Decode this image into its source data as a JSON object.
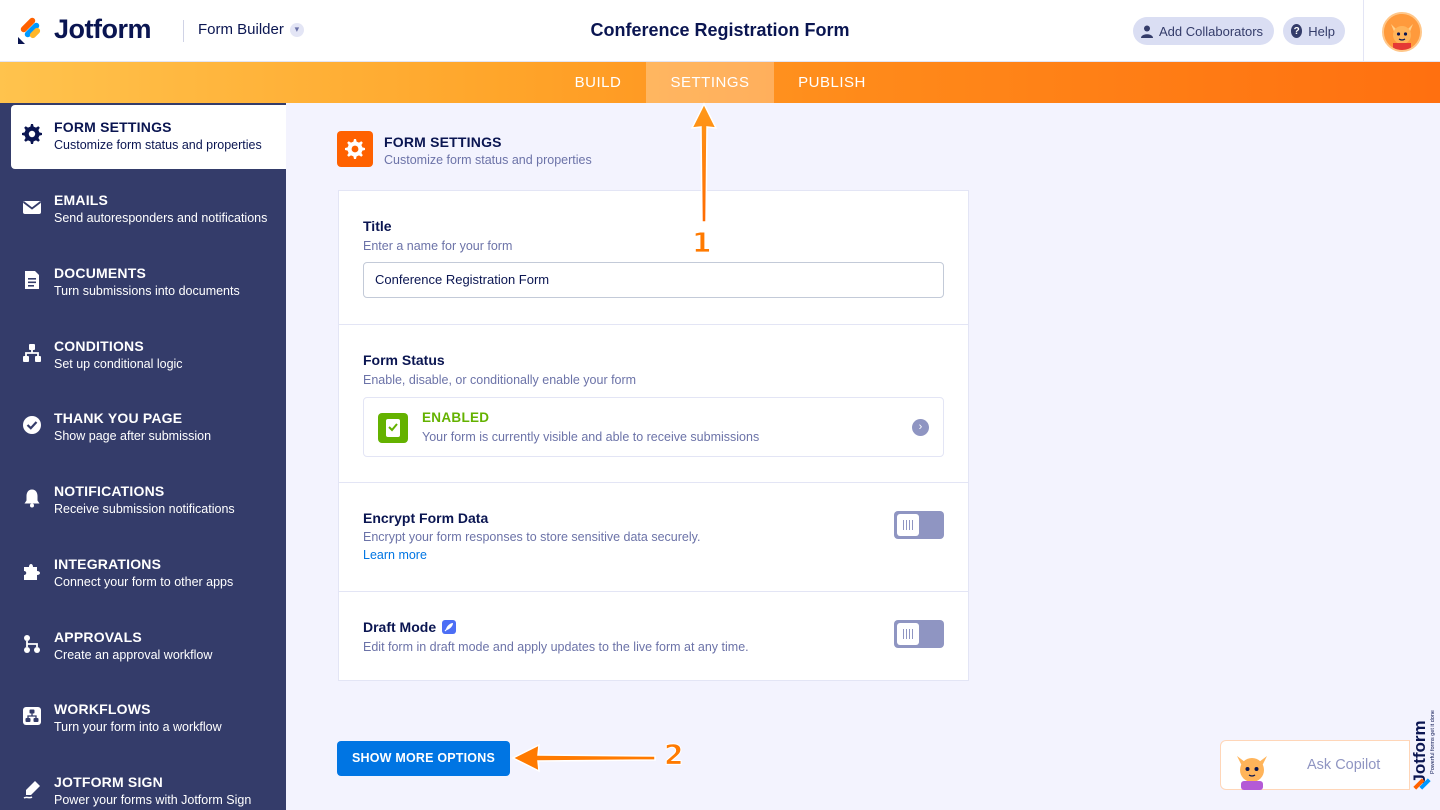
{
  "header": {
    "logo_text": "Jotform",
    "builder_label": "Form Builder",
    "form_title": "Conference Registration Form",
    "add_collaborators": "Add Collaborators",
    "help": "Help"
  },
  "tabs": [
    {
      "label": "BUILD",
      "active": false
    },
    {
      "label": "SETTINGS",
      "active": true
    },
    {
      "label": "PUBLISH",
      "active": false
    }
  ],
  "sidebar": {
    "items": [
      {
        "title": "FORM SETTINGS",
        "subtitle": "Customize form status and properties",
        "icon": "gear-icon",
        "active": true
      },
      {
        "title": "EMAILS",
        "subtitle": "Send autoresponders and notifications",
        "icon": "envelope-icon"
      },
      {
        "title": "DOCUMENTS",
        "subtitle": "Turn submissions into documents",
        "icon": "document-icon"
      },
      {
        "title": "CONDITIONS",
        "subtitle": "Set up conditional logic",
        "icon": "conditions-icon"
      },
      {
        "title": "THANK YOU PAGE",
        "subtitle": "Show page after submission",
        "icon": "check-circle-icon"
      },
      {
        "title": "NOTIFICATIONS",
        "subtitle": "Receive submission notifications",
        "icon": "bell-icon"
      },
      {
        "title": "INTEGRATIONS",
        "subtitle": "Connect your form to other apps",
        "icon": "puzzle-icon"
      },
      {
        "title": "APPROVALS",
        "subtitle": "Create an approval workflow",
        "icon": "approval-flow-icon"
      },
      {
        "title": "WORKFLOWS",
        "subtitle": "Turn your form into a workflow",
        "icon": "workflow-icon"
      },
      {
        "title": "JOTFORM SIGN",
        "subtitle": "Power your forms with Jotform Sign",
        "icon": "sign-pen-icon"
      }
    ]
  },
  "section": {
    "title": "FORM SETTINGS",
    "subtitle": "Customize form status and properties"
  },
  "settings": {
    "title_label": "Title",
    "title_desc": "Enter a name for your form",
    "title_value": "Conference Registration Form",
    "status_label": "Form Status",
    "status_desc": "Enable, disable, or conditionally enable your form",
    "status_value": "ENABLED",
    "status_detail": "Your form is currently visible and able to receive submissions",
    "encrypt_label": "Encrypt Form Data",
    "encrypt_desc": "Encrypt your form responses to store sensitive data securely.",
    "encrypt_link": "Learn more",
    "encrypt_on": false,
    "draft_label": "Draft Mode",
    "draft_desc": "Edit form in draft mode and apply updates to the live form at any time.",
    "draft_on": false
  },
  "show_more": "SHOW MORE OPTIONS",
  "copilot": {
    "label": "Ask Copilot"
  },
  "brand_side": {
    "name": "Jotform",
    "tagline": "Powerful forms get it done"
  },
  "annotations": {
    "one": "1",
    "two": "2"
  },
  "colors": {
    "brand_navy": "#0a1551",
    "sidebar_bg": "#343c6a",
    "accent_orange": "#ff6100",
    "enabled_green": "#64b200",
    "primary_blue": "#0075e3"
  }
}
